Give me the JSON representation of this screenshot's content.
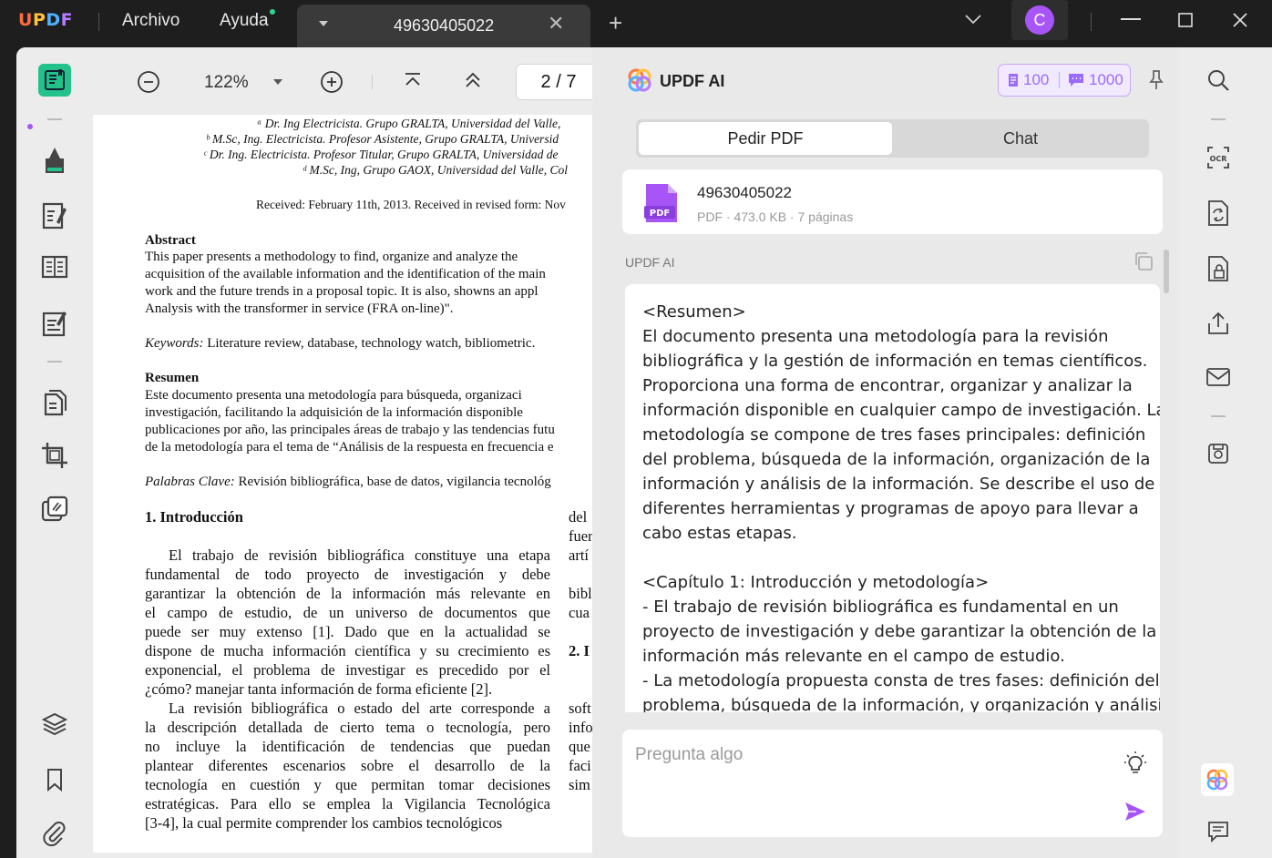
{
  "titlebar": {
    "logo_u": "U",
    "logo_p": "P",
    "logo_d": "D",
    "logo_f": "F",
    "menu_file": "Archivo",
    "menu_help": "Ayuda",
    "tab_name": "49630405022",
    "avatar_letter": "C"
  },
  "viewer": {
    "zoom": "122%",
    "page_indicator": "2 / 7"
  },
  "document": {
    "affiliations": [
      "ᵃ Dr. Ing Electricista. Grupo GRALTA, Universidad del Valle,",
      "ᵇ M.Sc, Ing. Electricista. Profesor Asistente, Grupo GRALTA, Universid",
      "ᶜ Dr. Ing. Electricista. Profesor Titular, Grupo GRALTA, Universidad de",
      "ᵈ M.Sc, Ing, Grupo GAOX, Universidad del Valle, Col"
    ],
    "received": "Received: February 11th, 2013. Received in revised form: Nov",
    "abstract_heading": "Abstract",
    "abstract_lines": [
      "This paper presents a methodology to find, organize and analyze the",
      "acquisition of the available information and the identification of the main",
      "work and the future trends in a proposal topic. It is also, showns an appl",
      "Analysis with the transformer in service (FRA on-line)\"."
    ],
    "keywords_label": "Keywords:",
    "keywords": " Literature review, database, technology watch, bibliometric.",
    "resumen_heading": "Resumen",
    "resumen_lines": [
      "Este documento presenta una metodología para búsqueda, organizaci",
      "investigación, facilitando la adquisición de la información disponible",
      "publicaciones por año, las principales áreas de trabajo y las tendencias futu",
      "de la metodología para el tema  de “Análisis de la respuesta en frecuencia e"
    ],
    "palabras_label": "Palabras Clave:",
    "palabras": " Revisión bibliográfica, base de datos, vigilancia tecnológ",
    "intro_heading": "1. Introducción",
    "col1_lines": [
      "El trabajo de revisión bibliográfica constituye una etapa",
      "fundamental de todo proyecto de investigación y debe",
      "garantizar la obtención de la información más relevante en",
      "el campo de estudio, de un universo de documentos que",
      "puede ser muy extenso [1]. Dado que en la actualidad se",
      "dispone de mucha información científica y su crecimiento es",
      "exponencial, el problema de investigar es precedido por el",
      "¿cómo? manejar tanta información de forma eficiente [2].",
      "La revisión bibliográfica o estado del arte corresponde a",
      "la  descripción detallada de cierto tema o  tecnología, pero",
      "no incluye la identificación de  tendencias que puedan",
      "plantear diferentes escenarios sobre el desarrollo de la",
      "tecnología en cuestión y que permitan tomar decisiones",
      "estratégicas. Para ello se emplea la Vigilancia Tecnológica",
      "[3-4], la cual permite comprender los cambios tecnológicos"
    ],
    "col2_lines": [
      "del",
      "fuer",
      "artí",
      "",
      "bibl",
      "cua",
      "",
      "2. I",
      "",
      "",
      "soft",
      "info",
      "que",
      "faci",
      "sim"
    ]
  },
  "ai": {
    "title": "UPDF AI",
    "quota_pages": "100",
    "quota_chat": "1000",
    "tab_pdf": "Pedir PDF",
    "tab_chat": "Chat",
    "file_name": "49630405022",
    "file_icon_label": "PDF",
    "file_meta": "PDF · 473.0 KB · 7 páginas",
    "response_label": "UPDF AI",
    "answer_lines": [
      "<Resumen>",
      "El documento presenta una metodología para la revisión",
      "bibliográfica y la gestión de información en temas científicos.",
      "Proporciona una forma de encontrar, organizar y analizar la",
      "información disponible en cualquier campo de investigación. La",
      "metodología se compone de tres fases principales: definición",
      "del problema, búsqueda de la información, organización de la",
      "información y análisis de la información. Se describe el uso de",
      "diferentes herramientas y programas de apoyo para llevar a",
      "cabo estas etapas.",
      "",
      "<Capítulo 1: Introducción y metodología>",
      "- El trabajo de revisión bibliográfica es fundamental en un",
      "proyecto de investigación y debe garantizar la obtención de la",
      "información más relevante en el campo de estudio.",
      "- La metodología propuesta consta de tres fases: definición del",
      "problema, búsqueda de la información, y organización y análisis"
    ],
    "ask_placeholder": "Pregunta algo"
  },
  "colors": {
    "accent_green": "#22c28a",
    "accent_purple": "#a855f7",
    "quota_purple": "#9b6bff"
  }
}
